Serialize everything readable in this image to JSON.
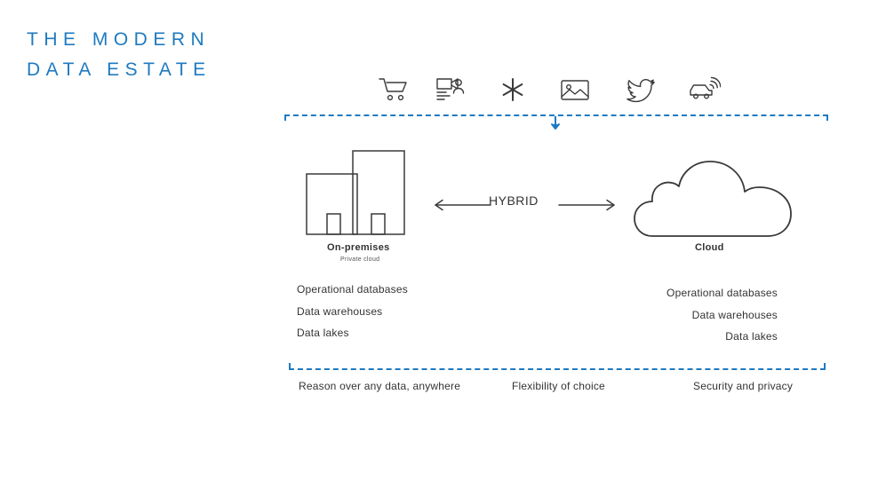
{
  "title": {
    "line1": "THE MODERN",
    "line2": "DATA ESTATE"
  },
  "colors": {
    "accent": "#1f7ac0",
    "stroke": "#3a3a3a",
    "text": "#333333"
  },
  "icons": [
    {
      "name": "shopping-cart-icon"
    },
    {
      "name": "video-conference-icon"
    },
    {
      "name": "asterisk-icon"
    },
    {
      "name": "image-icon"
    },
    {
      "name": "twitter-bird-icon"
    },
    {
      "name": "connected-car-icon"
    }
  ],
  "diagram": {
    "onprem": {
      "label": "On-premises",
      "sublabel": "Private cloud",
      "items": [
        "Operational databases",
        "Data warehouses",
        "Data lakes"
      ]
    },
    "cloud": {
      "label": "Cloud",
      "items": [
        "Operational databases",
        "Data warehouses",
        "Data lakes"
      ]
    },
    "hybrid_label": "HYBRID"
  },
  "footer": {
    "pillars": [
      "Reason over any data, anywhere",
      "Flexibility of choice",
      "Security and privacy"
    ]
  }
}
